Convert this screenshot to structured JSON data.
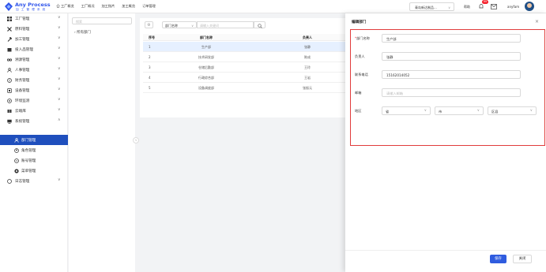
{
  "app": {
    "name": "Any Process",
    "subtitle": "加 工 管 理 系 统"
  },
  "topnav": [
    "工厂概览",
    "工厂概况",
    "加工指片",
    "加工概览",
    "订单管理"
  ],
  "topbar": {
    "factory": "青岛新达制品...",
    "help": "帮助",
    "notice_count": "99",
    "user": "anyfam"
  },
  "sidebar": {
    "items": [
      {
        "label": "工厂管理",
        "icon": "grid-icon",
        "chevron": "∨"
      },
      {
        "label": "原料管理",
        "icon": "tools-icon",
        "chevron": "∨"
      },
      {
        "label": "加工管理",
        "icon": "hammer-icon",
        "chevron": "∨"
      },
      {
        "label": "投入品管理",
        "icon": "box-icon",
        "chevron": "∨"
      },
      {
        "label": "溯源管理",
        "icon": "link-icon",
        "chevron": "∨"
      },
      {
        "label": "人事管理",
        "icon": "people-icon",
        "chevron": "∨"
      },
      {
        "label": "财务管理",
        "icon": "coin-icon",
        "chevron": "∨"
      },
      {
        "label": "设备管理",
        "icon": "device-icon",
        "chevron": "∨"
      },
      {
        "label": "环境监测",
        "icon": "monitor-icon",
        "chevron": "∨"
      },
      {
        "label": "云端库",
        "icon": "cloud-icon",
        "chevron": "∨"
      },
      {
        "label": "系统管理",
        "icon": "screen-icon",
        "chevron": "∧"
      }
    ],
    "sub_items": [
      {
        "label": "部门管理",
        "icon": "user-icon"
      },
      {
        "label": "角色管理",
        "icon": "group-icon"
      },
      {
        "label": "账号管理",
        "icon": "account-icon"
      },
      {
        "label": "菜单管理",
        "icon": "gear-icon"
      }
    ],
    "last": {
      "label": "日志管理",
      "icon": "log-icon",
      "chevron": "∨"
    }
  },
  "tree": {
    "search_placeholder": "搜索",
    "root": "所有部门"
  },
  "filter": {
    "field": "部门名称",
    "placeholder": "请输入关键词"
  },
  "table": {
    "columns": [
      "序号",
      "部门名称",
      "负责人"
    ],
    "rows": [
      [
        "1",
        "生产部",
        "张静"
      ],
      [
        "2",
        "技术研发部",
        "陈成"
      ],
      [
        "3",
        "仓储后勤部",
        "王玲"
      ],
      [
        "4",
        "行政综合部",
        "王岩"
      ],
      [
        "5",
        "设备调度部",
        "张振元"
      ]
    ]
  },
  "drawer": {
    "title": "编辑部门",
    "close": "×",
    "fields": {
      "dept_label": "部门名称",
      "dept_value": "生产部",
      "leader_label": "负责人",
      "leader_value": "张静",
      "phone_label": "联系电话",
      "phone_value": "15162014052",
      "email_label": "邮箱",
      "email_placeholder": "请输入邮箱",
      "region_label": "地区",
      "province": "省",
      "city": "市",
      "district": "区县"
    },
    "save": "保存",
    "cancel": "关闭"
  },
  "colors": {
    "primary": "#2f5cdf",
    "sidebar_active": "#1f4fbd",
    "error_frame": "#e13c3c"
  }
}
